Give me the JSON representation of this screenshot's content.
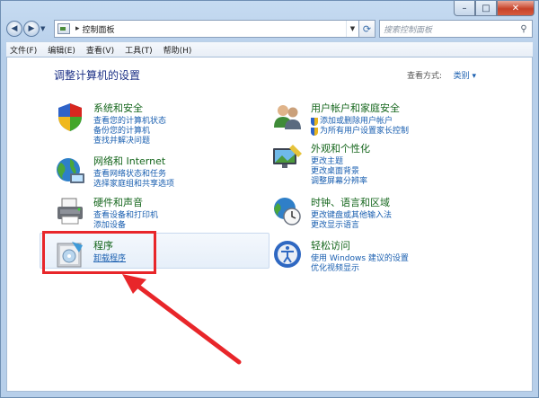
{
  "window": {
    "caption": {
      "minimize": "–",
      "maximize": "□",
      "close": "✕"
    }
  },
  "address": {
    "path": "控制面板",
    "search_placeholder": "搜索控制面板"
  },
  "menu": [
    "文件(F)",
    "编辑(E)",
    "查看(V)",
    "工具(T)",
    "帮助(H)"
  ],
  "heading": "调整计算机的设置",
  "view": {
    "label": "查看方式:",
    "mode": "类别 ▾"
  },
  "categories": {
    "system": {
      "title": "系统和安全",
      "links": [
        "查看您的计算机状态",
        "备份您的计算机",
        "查找并解决问题"
      ]
    },
    "network": {
      "title": "网络和 Internet",
      "links": [
        "查看网络状态和任务",
        "选择家庭组和共享选项"
      ]
    },
    "hardware": {
      "title": "硬件和声音",
      "links": [
        "查看设备和打印机",
        "添加设备"
      ]
    },
    "programs": {
      "title": "程序",
      "links": [
        "卸载程序"
      ]
    },
    "users": {
      "title": "用户帐户和家庭安全",
      "links": [
        "添加或删除用户帐户",
        "为所有用户设置家长控制"
      ]
    },
    "appearance": {
      "title": "外观和个性化",
      "links": [
        "更改主题",
        "更改桌面背景",
        "调整屏幕分辨率"
      ]
    },
    "clock": {
      "title": "时钟、语言和区域",
      "links": [
        "更改键盘或其他输入法",
        "更改显示语言"
      ]
    },
    "ease": {
      "title": "轻松访问",
      "links": [
        "使用 Windows 建议的设置",
        "优化视频显示"
      ]
    }
  },
  "colors": {
    "highlight_box": "#e8262a",
    "link": "#1a5fb0",
    "title": "#15661c"
  }
}
